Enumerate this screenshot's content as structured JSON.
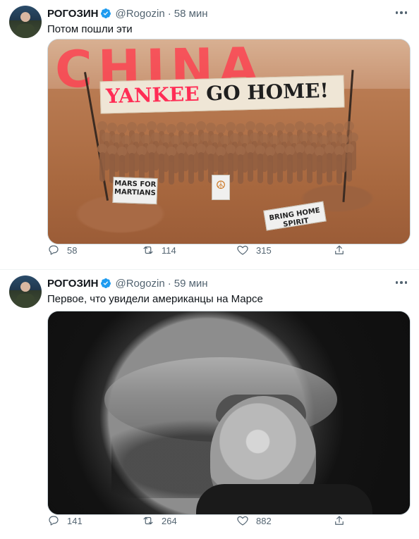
{
  "colors": {
    "text_primary": "#0f1419",
    "text_secondary": "#536471",
    "verified_blue": "#1d9bf0",
    "border": "#cfd9de",
    "divider": "#eff3f4",
    "china_red": "#ff3b4d"
  },
  "tweets": [
    {
      "author_name": "РОГОЗИН",
      "handle": "@Rogozin",
      "separator": "·",
      "time": "58 мин",
      "text": "Потом пошли эти",
      "image": {
        "overlay_text": "CHINA",
        "banner_prefix": "YANKEE",
        "banner_suffix": "GO HOME!",
        "sign_1": "MARS FOR MARTIANS",
        "sign_2": "☮",
        "sign_3": "BRING HOME SPIRIT"
      },
      "counts": {
        "replies": "58",
        "retweets": "114",
        "likes": "315"
      }
    },
    {
      "author_name": "РОГОЗИН",
      "handle": "@Rogozin",
      "separator": "·",
      "time": "59 мин",
      "text": "Первое, что увидели американцы на Марсе",
      "counts": {
        "replies": "141",
        "retweets": "264",
        "likes": "882"
      }
    }
  ],
  "icons": {
    "more": "more-horizontal-icon",
    "verified": "verified-badge-icon",
    "reply": "reply-icon",
    "retweet": "retweet-icon",
    "like": "heart-icon",
    "share": "share-icon"
  }
}
